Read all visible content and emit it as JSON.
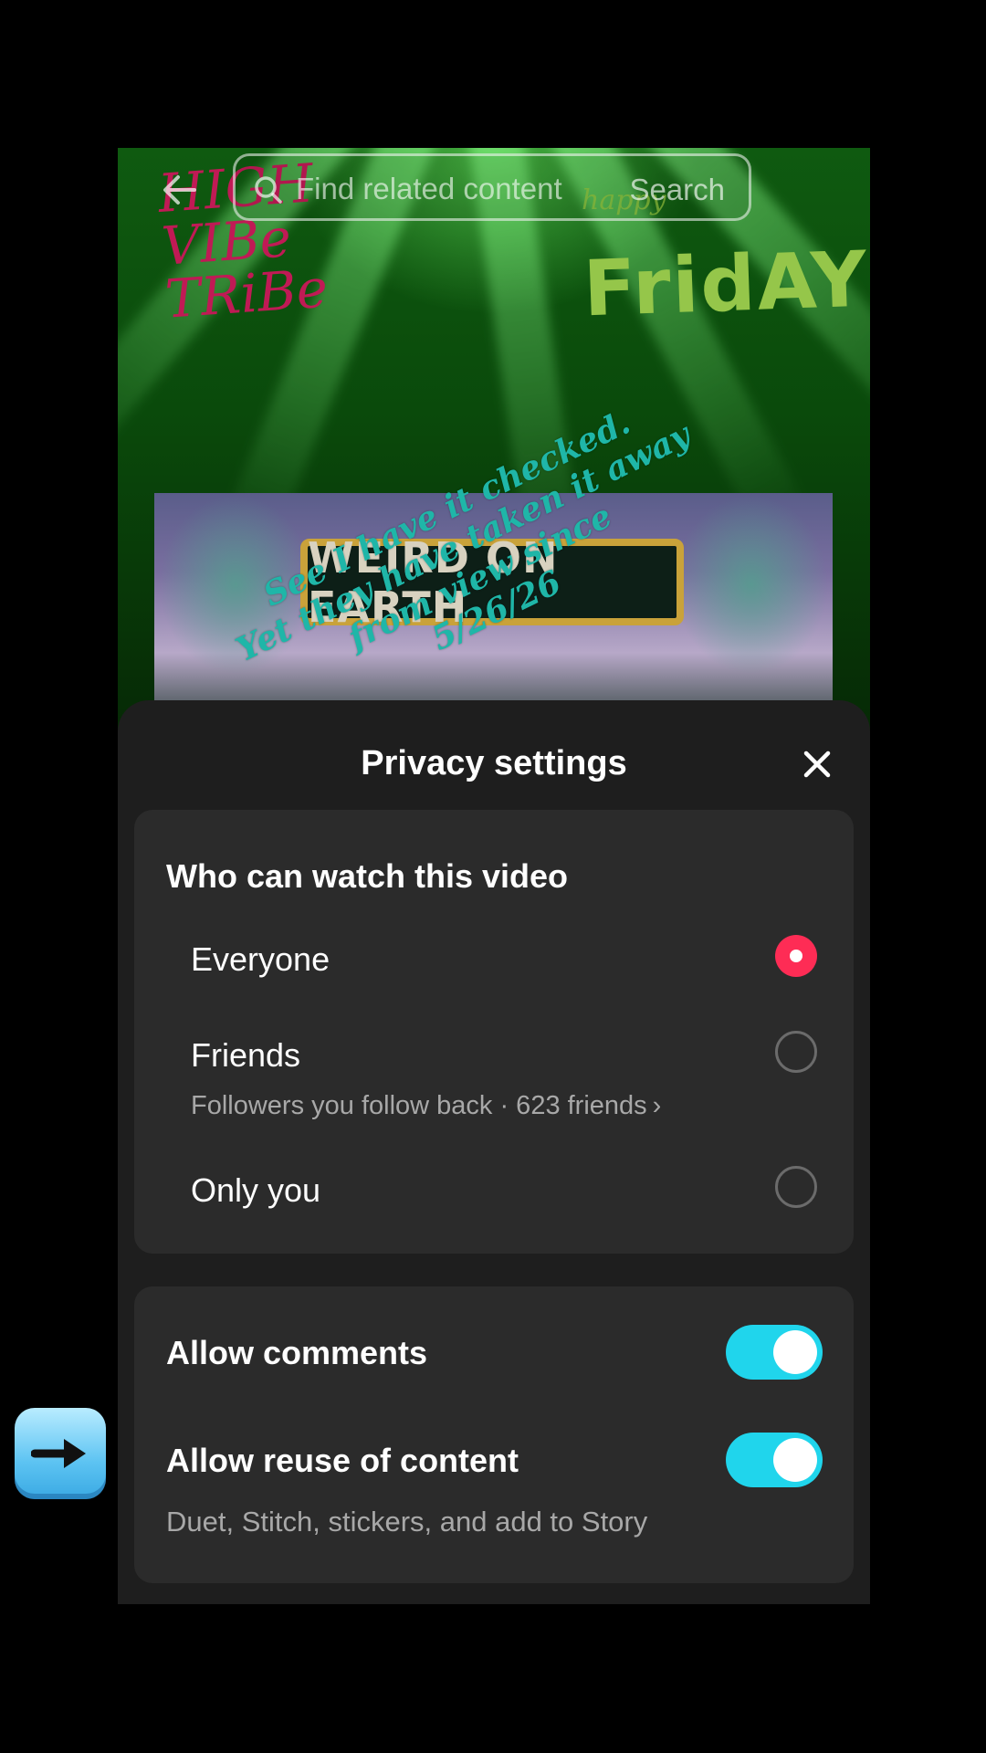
{
  "search": {
    "placeholder": "Find related content",
    "button_label": "Search"
  },
  "background_art": {
    "left_logo_lines": [
      "HIGH",
      "VIBe",
      "TRiBe"
    ],
    "happy_text": "happy",
    "friday_text": "FridAY",
    "banner_sign": "WEIRD ON EARTH"
  },
  "overlay_caption": {
    "lines": [
      "See I have it checked.",
      "Yet they have taken it away",
      "from view since",
      "5/26/26"
    ],
    "color": "#1fb6a8"
  },
  "privacy_sheet": {
    "title": "Privacy settings",
    "close_icon": "close-icon",
    "who_can_watch": {
      "heading": "Who can watch this video",
      "options": [
        {
          "label": "Everyone",
          "selected": true
        },
        {
          "label": "Friends",
          "selected": false,
          "subtext": "Followers you follow back · 623 friends"
        },
        {
          "label": "Only you",
          "selected": false
        }
      ]
    },
    "toggles": [
      {
        "label": "Allow comments",
        "on": true
      },
      {
        "label": "Allow reuse of content",
        "on": true,
        "subtext": "Duet, Stitch, stickers, and add to Story"
      }
    ]
  },
  "colors": {
    "accent_red": "#fe2c55",
    "toggle_cyan": "#20d5ec",
    "sheet_bg": "#1e1e1e",
    "card_bg": "#2b2b2b"
  },
  "side_emoji": "right-arrow-icon"
}
